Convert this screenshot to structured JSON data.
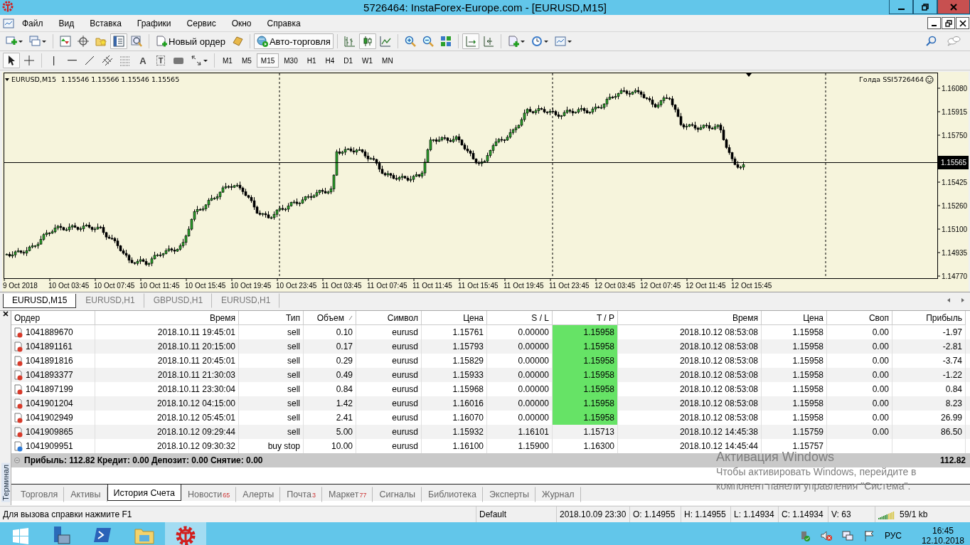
{
  "window": {
    "title": "5726464: InstaForex-Europe.com - [EURUSD,M15]"
  },
  "menu": [
    "Файл",
    "Вид",
    "Вставка",
    "Графики",
    "Сервис",
    "Окно",
    "Справка"
  ],
  "main_toolbar": [
    {
      "pressed": false
    },
    {
      "pressed": false
    },
    {
      "pressed": false
    },
    {
      "pressed": false
    },
    {
      "pressed": false
    },
    {
      "pressed": true
    },
    {
      "pressed": false
    },
    {
      "pressed": false,
      "label": "Новый ордер"
    },
    {
      "pressed": false
    },
    {
      "pressed": true,
      "label": "Авто-торговля"
    },
    {
      "pressed": false
    },
    {
      "pressed": true
    },
    {
      "pressed": false
    },
    {
      "pressed": false
    },
    {
      "pressed": false
    },
    {
      "pressed": false
    },
    {
      "pressed": true
    },
    {
      "pressed": false
    },
    {
      "pressed": false
    },
    {
      "pressed": false
    },
    {
      "pressed": false
    }
  ],
  "drawing_toolbar": [
    {
      "pressed": true
    },
    {
      "pressed": false
    },
    {
      "pressed": false
    },
    {
      "pressed": false
    },
    {
      "pressed": false
    },
    {
      "pressed": false
    },
    {
      "pressed": false
    },
    {
      "pressed": false,
      "glyph": "A"
    },
    {
      "pressed": false,
      "glyph": "T"
    },
    {
      "pressed": false
    },
    {
      "pressed": false
    }
  ],
  "timeframes": [
    {
      "label": "M1",
      "selected": false
    },
    {
      "label": "M5",
      "selected": false
    },
    {
      "label": "M15",
      "selected": true
    },
    {
      "label": "M30",
      "selected": false
    },
    {
      "label": "H1",
      "selected": false
    },
    {
      "label": "H4",
      "selected": false
    },
    {
      "label": "D1",
      "selected": false
    },
    {
      "label": "W1",
      "selected": false
    },
    {
      "label": "MN",
      "selected": false
    }
  ],
  "chart": {
    "symbol": "EURUSD,M15",
    "ohlc": "1.15546 1.15566 1.15546 1.15565",
    "account_name": "Голда SSI",
    "account_number": "5726464",
    "price_ticks": [
      "1.16080",
      "1.15915",
      "1.15750",
      "1.15425",
      "1.15260",
      "1.15100",
      "1.14935",
      "1.14770"
    ],
    "current_price": "1.15565",
    "time_labels": [
      "9 Oct 2018",
      "10 Oct 03:45",
      "10 Oct 07:45",
      "10 Oct 11:45",
      "10 Oct 15:45",
      "10 Oct 19:45",
      "10 Oct 23:45",
      "11 Oct 03:45",
      "11 Oct 07:45",
      "11 Oct 11:45",
      "11 Oct 15:45",
      "11 Oct 19:45",
      "11 Oct 23:45",
      "12 Oct 03:45",
      "12 Oct 07:45",
      "12 Oct 11:45",
      "12 Oct 15:45"
    ]
  },
  "chart_tabs": [
    {
      "label": "EURUSD,M15",
      "selected": true
    },
    {
      "label": "EURUSD,H1",
      "selected": false
    },
    {
      "label": "GBPUSD,H1",
      "selected": false
    },
    {
      "label": "EURUSD,H1",
      "selected": false
    }
  ],
  "terminal": {
    "title": "Терминал",
    "columns": [
      "Ордер",
      "Время",
      "Тип",
      "Объем",
      "Символ",
      "Цена",
      "S / L",
      "T / P",
      "Время",
      "Цена",
      "Своп",
      "Прибыль"
    ],
    "rows": [
      {
        "kind": "sell",
        "tp_hit": true,
        "cells": [
          "1041889670",
          "2018.10.11 19:45:01",
          "sell",
          "0.10",
          "eurusd",
          "1.15761",
          "0.00000",
          "1.15958",
          "2018.10.12 08:53:08",
          "1.15958",
          "0.00",
          "-1.97"
        ]
      },
      {
        "kind": "sell",
        "tp_hit": true,
        "cells": [
          "1041891161",
          "2018.10.11 20:15:00",
          "sell",
          "0.17",
          "eurusd",
          "1.15793",
          "0.00000",
          "1.15958",
          "2018.10.12 08:53:08",
          "1.15958",
          "0.00",
          "-2.81"
        ]
      },
      {
        "kind": "sell",
        "tp_hit": true,
        "cells": [
          "1041891816",
          "2018.10.11 20:45:01",
          "sell",
          "0.29",
          "eurusd",
          "1.15829",
          "0.00000",
          "1.15958",
          "2018.10.12 08:53:08",
          "1.15958",
          "0.00",
          "-3.74"
        ]
      },
      {
        "kind": "sell",
        "tp_hit": true,
        "cells": [
          "1041893377",
          "2018.10.11 21:30:03",
          "sell",
          "0.49",
          "eurusd",
          "1.15933",
          "0.00000",
          "1.15958",
          "2018.10.12 08:53:08",
          "1.15958",
          "0.00",
          "-1.22"
        ]
      },
      {
        "kind": "sell",
        "tp_hit": true,
        "cells": [
          "1041897199",
          "2018.10.11 23:30:04",
          "sell",
          "0.84",
          "eurusd",
          "1.15968",
          "0.00000",
          "1.15958",
          "2018.10.12 08:53:08",
          "1.15958",
          "0.00",
          "0.84"
        ]
      },
      {
        "kind": "sell",
        "tp_hit": true,
        "cells": [
          "1041901204",
          "2018.10.12 04:15:00",
          "sell",
          "1.42",
          "eurusd",
          "1.16016",
          "0.00000",
          "1.15958",
          "2018.10.12 08:53:08",
          "1.15958",
          "0.00",
          "8.23"
        ]
      },
      {
        "kind": "sell",
        "tp_hit": true,
        "cells": [
          "1041902949",
          "2018.10.12 05:45:01",
          "sell",
          "2.41",
          "eurusd",
          "1.16070",
          "0.00000",
          "1.15958",
          "2018.10.12 08:53:08",
          "1.15958",
          "0.00",
          "26.99"
        ]
      },
      {
        "kind": "sell",
        "tp_hit": false,
        "cells": [
          "1041909865",
          "2018.10.12 09:29:44",
          "sell",
          "5.00",
          "eurusd",
          "1.15932",
          "1.16101",
          "1.15713",
          "2018.10.12 14:45:38",
          "1.15759",
          "0.00",
          "86.50"
        ]
      },
      {
        "kind": "pending",
        "tp_hit": false,
        "cells": [
          "1041909951",
          "2018.10.12 09:30:32",
          "buy stop",
          "10.00",
          "eurusd",
          "1.16100",
          "1.15900",
          "1.16300",
          "2018.10.12 14:45:44",
          "1.15757"
        ]
      }
    ],
    "summary": "Прибыль: 112.82  Кредит: 0.00  Депозит: 0.00  Снятие: 0.00",
    "total": "112.82",
    "tabs": [
      {
        "label": "Торговля",
        "selected": false
      },
      {
        "label": "Активы",
        "selected": false
      },
      {
        "label": "История Счета",
        "selected": true
      },
      {
        "label": "Новости",
        "badge": "65",
        "selected": false
      },
      {
        "label": "Алерты",
        "selected": false
      },
      {
        "label": "Почта",
        "badge": "3",
        "selected": false
      },
      {
        "label": "Маркет",
        "badge": "77",
        "selected": false
      },
      {
        "label": "Сигналы",
        "selected": false
      },
      {
        "label": "Библиотека",
        "selected": false
      },
      {
        "label": "Эксперты",
        "selected": false
      },
      {
        "label": "Журнал",
        "selected": false
      }
    ]
  },
  "activation_notice": {
    "title": "Активация Windows",
    "text": "Чтобы активировать Windows, перейдите в\nкомпонент панели управления \"Система\"."
  },
  "status_bar": [
    "Для вызова справки нажмите F1",
    "Default",
    "2018.10.09 23:30",
    "O: 1.14955",
    "H: 1.14955",
    "L: 1.14934",
    "C: 1.14934",
    "V: 63",
    "59/1 kb"
  ],
  "taskbar": {
    "apps": [
      {
        "active": false
      },
      {
        "active": false
      },
      {
        "active": false
      },
      {
        "active": true
      }
    ],
    "language": "РУС",
    "time": "16:45",
    "date": "12.10.2018"
  }
}
